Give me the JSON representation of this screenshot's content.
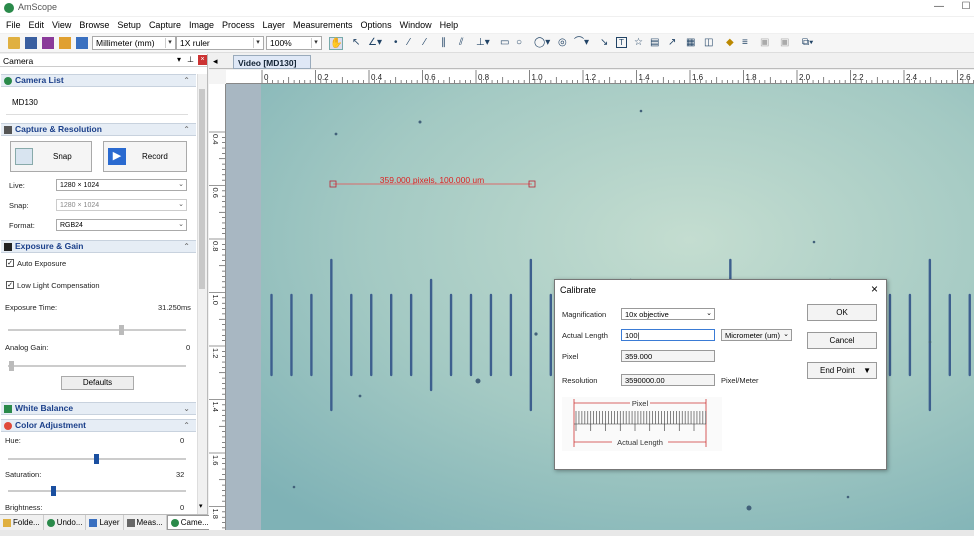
{
  "app": {
    "title": "AmScope"
  },
  "menu": [
    "File",
    "Edit",
    "View",
    "Browse",
    "Setup",
    "Capture",
    "Image",
    "Process",
    "Layer",
    "Measurements",
    "Options",
    "Window",
    "Help"
  ],
  "toolbar": {
    "unit": "Millimeter (mm)",
    "ruler": "1X ruler",
    "zoom": "100%"
  },
  "camera_panel": {
    "title": "Camera",
    "camera_list": {
      "heading": "Camera List",
      "items": [
        "MD130"
      ]
    },
    "capture": {
      "heading": "Capture & Resolution",
      "snap_label": "Snap",
      "record_label": "Record",
      "live_label": "Live:",
      "live_value": "1280 × 1024",
      "snap_res_label": "Snap:",
      "snap_res_value": "1280 × 1024",
      "format_label": "Format:",
      "format_value": "RGB24"
    },
    "exposure": {
      "heading": "Exposure & Gain",
      "auto_label": "Auto Exposure",
      "auto_checked": "✓",
      "lowlight_label": "Low Light Compensation",
      "lowlight_checked": "✓",
      "time_label": "Exposure Time:",
      "time_value": "31.250ms",
      "gain_label": "Analog Gain:",
      "gain_value": "0",
      "defaults_label": "Defaults"
    },
    "white_balance": {
      "heading": "White Balance"
    },
    "color": {
      "heading": "Color Adjustment",
      "hue_label": "Hue:",
      "hue_value": "0",
      "sat_label": "Saturation:",
      "sat_value": "32",
      "bright_label": "Brightness:",
      "bright_value": "0"
    }
  },
  "bottom_tabs": [
    "Folde...",
    "Undo...",
    "Layer",
    "Meas...",
    "Came..."
  ],
  "document": {
    "tab": "Video [MD130]"
  },
  "ruler_top": [
    "0",
    "0.2",
    "0.4",
    "0.6",
    "0.8",
    "1.0",
    "1.2",
    "1.4",
    "1.6",
    "1.8",
    "2.0",
    "2.2",
    "2.4",
    "2.6"
  ],
  "ruler_left": [
    "0.4",
    "0.6",
    "0.8",
    "1.0",
    "1.2",
    "1.4",
    "1.6",
    "1.8"
  ],
  "measurement": {
    "label": "359.000 pixels, 100.000 um"
  },
  "dialog": {
    "title": "Calibrate",
    "magnification_label": "Magnification",
    "magnification_value": "10x objective",
    "length_label": "Actual Length",
    "length_value": "100",
    "length_unit": "Micrometer (um)",
    "pixel_label": "Pixel",
    "pixel_value": "359.000",
    "resolution_label": "Resolution",
    "resolution_value": "3590000.00",
    "resolution_unit": "Pixel/Meter",
    "ok_label": "OK",
    "cancel_label": "Cancel",
    "endpoint_label": "End Point",
    "diagram_pixel": "Pixel",
    "diagram_length": "Actual Length"
  }
}
